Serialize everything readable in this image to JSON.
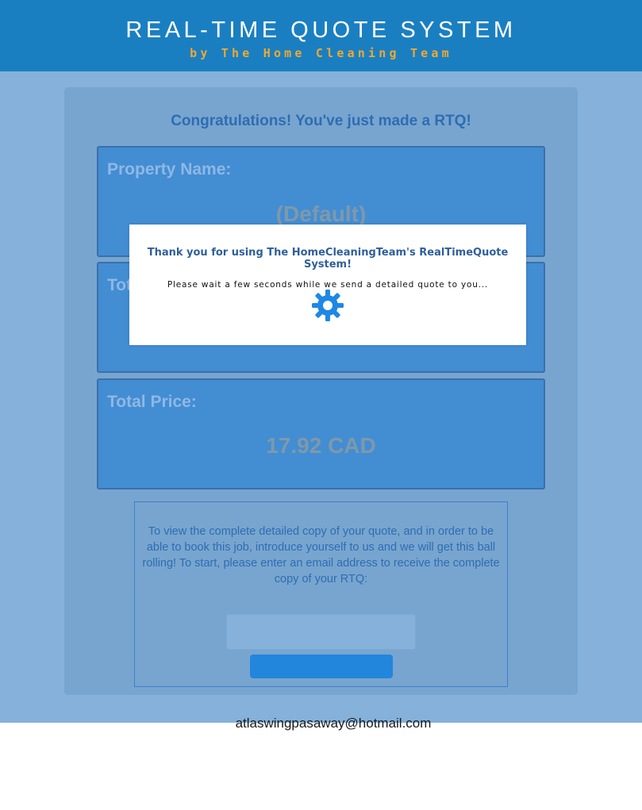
{
  "header": {
    "title": "REAL-TIME QUOTE SYSTEM",
    "subtitle": "by The Home Cleaning Team"
  },
  "main": {
    "congrats": "Congratulations! You've just made a RTQ!",
    "boxes": [
      {
        "label": "Property Name:",
        "value": "(Default)"
      },
      {
        "label": "Tot",
        "value": ""
      },
      {
        "label": "Total Price:",
        "value": "17.92 CAD"
      }
    ],
    "instructions": "To view the complete detailed copy of your quote, and in order to be able to book this job, introduce yourself to us and we will get this ball rolling! To start, please enter an email address to receive the complete copy of your RTQ:",
    "email_input_value": "",
    "submit_label": ""
  },
  "modal": {
    "title": "Thank you for using The HomeCleaningTeam's RealTimeQuote System!",
    "message": "Please wait a few seconds while we send a detailed quote to you...",
    "spinner_icon": "gear-spinner-icon"
  },
  "email_echo": "atlaswingpasaway@hotmail.com",
  "colors": {
    "header": "#1a7fc1",
    "accent": "#f0a830",
    "overlay": "#85b1da",
    "box": "#438dd3",
    "spinner": "#1e88e5"
  }
}
